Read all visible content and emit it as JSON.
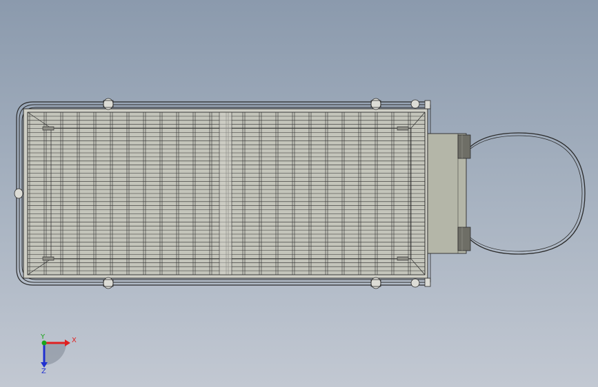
{
  "viewport": {
    "background_top": "#8b9aad",
    "background_bottom": "#c2c8d2"
  },
  "model": {
    "frame_color": "#e2e2de",
    "line_color": "#2a2a2a",
    "mesh_fill": "#c8c8c0",
    "bracket_fill": "#b4b6a8",
    "clamp_fill": "#6e6e66"
  },
  "triad": {
    "x_label": "X",
    "y_label": "Y",
    "z_label": "Z",
    "x_color": "#e02020",
    "y_color": "#1aa61a",
    "z_color": "#2030d0"
  }
}
